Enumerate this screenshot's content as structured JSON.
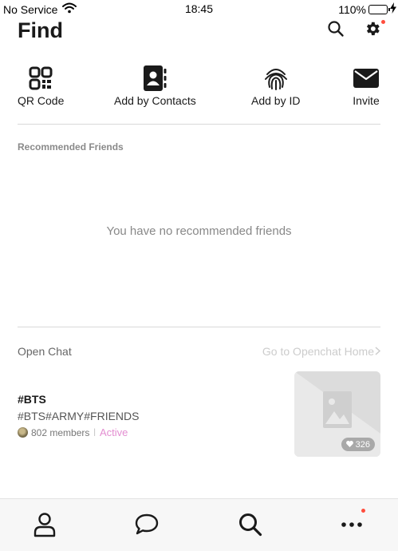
{
  "status_bar": {
    "carrier": "No Service",
    "time": "18:45",
    "battery": "110%"
  },
  "header": {
    "title": "Find",
    "icons": [
      "search-icon",
      "gear-icon"
    ]
  },
  "quick_actions": [
    {
      "label": "QR Code",
      "icon": "qr-code-icon"
    },
    {
      "label": "Add by Contacts",
      "icon": "contacts-book-icon"
    },
    {
      "label": "Add by ID",
      "icon": "fingerprint-icon"
    },
    {
      "label": "Invite",
      "icon": "envelope-icon"
    }
  ],
  "recommended": {
    "title": "Recommended Friends",
    "empty_message": "You have no recommended friends"
  },
  "open_chat": {
    "label": "Open Chat",
    "home_link": "Go to Openchat Home",
    "items": [
      {
        "name": "#BTS",
        "tags": "#BTS#ARMY#FRIENDS",
        "members": "802 members",
        "status": "Active",
        "likes": "326"
      }
    ]
  },
  "tab_bar": {
    "tabs": [
      "person-icon",
      "chat-bubble-icon",
      "search-icon",
      "more-dots-icon"
    ]
  },
  "colors": {
    "accent_pink": "#e38ed1",
    "notification_red": "#ff4d3d"
  }
}
